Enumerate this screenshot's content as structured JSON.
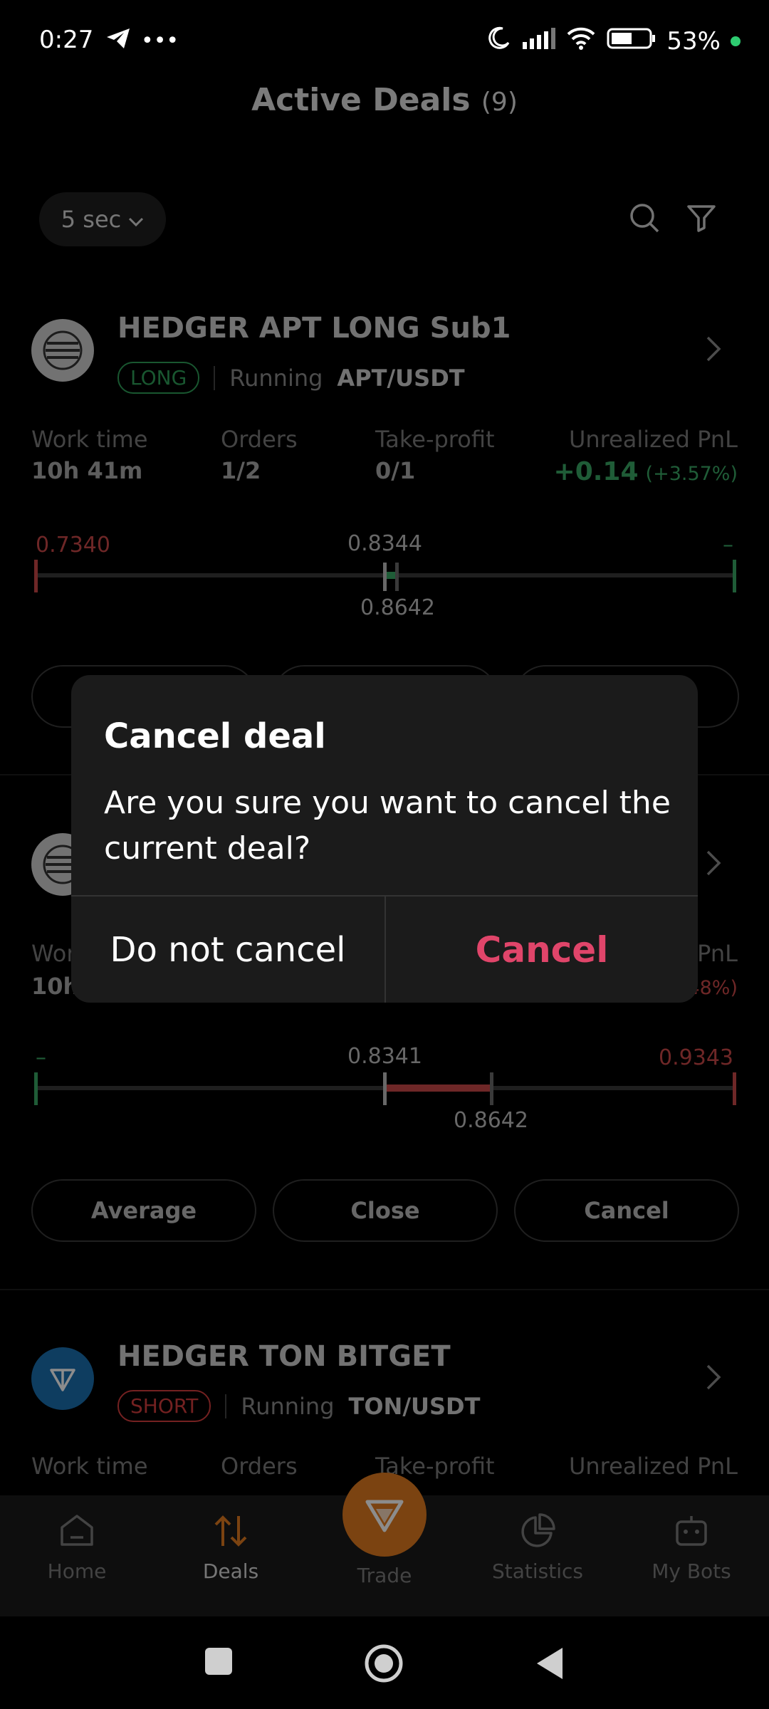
{
  "status": {
    "time": "0:27",
    "battery": "53%"
  },
  "header": {
    "title": "Active Deals",
    "count": "(9)"
  },
  "filter": {
    "refresh": "5 sec"
  },
  "cards": [
    {
      "name": "HEDGER APT LONG Sub1",
      "side": "LONG",
      "state": "Running",
      "pair": "APT/USDT",
      "work_time_label": "Work time",
      "work_time": "10h 41m",
      "orders_label": "Orders",
      "orders": "1/2",
      "tp_label": "Take-profit",
      "tp": "0/1",
      "pnl_label": "Unrealized PnL",
      "pnl": "+0.14",
      "pnl_pct": "(+3.57%)",
      "range_left": "0.7340",
      "range_mid": "0.8344",
      "range_cur": "0.8642",
      "range_right": "–"
    },
    {
      "work_label_partial": "Wor",
      "work_time_partial": "10h",
      "pnl_label_partial": "PnL",
      "pnl_pct_partial": "48%)",
      "range_left": "–",
      "range_mid": "0.8341",
      "range_cur": "0.8642",
      "range_right": "0.9343",
      "buttons": [
        "Average",
        "Close",
        "Cancel"
      ]
    },
    {
      "name": "HEDGER TON BITGET",
      "side": "SHORT",
      "state": "Running",
      "pair": "TON/USDT",
      "work_time_label": "Work time",
      "orders_label": "Orders",
      "tp_label": "Take-profit",
      "pnl_label": "Unrealized PnL"
    }
  ],
  "dialog": {
    "title": "Cancel deal",
    "message": "Are you sure you want to cancel the current deal?",
    "dismiss": "Do not cancel",
    "confirm": "Cancel"
  },
  "nav": {
    "home": "Home",
    "deals": "Deals",
    "trade": "Trade",
    "statistics": "Statistics",
    "mybots": "My Bots"
  },
  "colors": {
    "accent": "#e07a1f",
    "positive": "#2e9e58",
    "negative": "#d33c3c",
    "danger": "#e0456a"
  }
}
